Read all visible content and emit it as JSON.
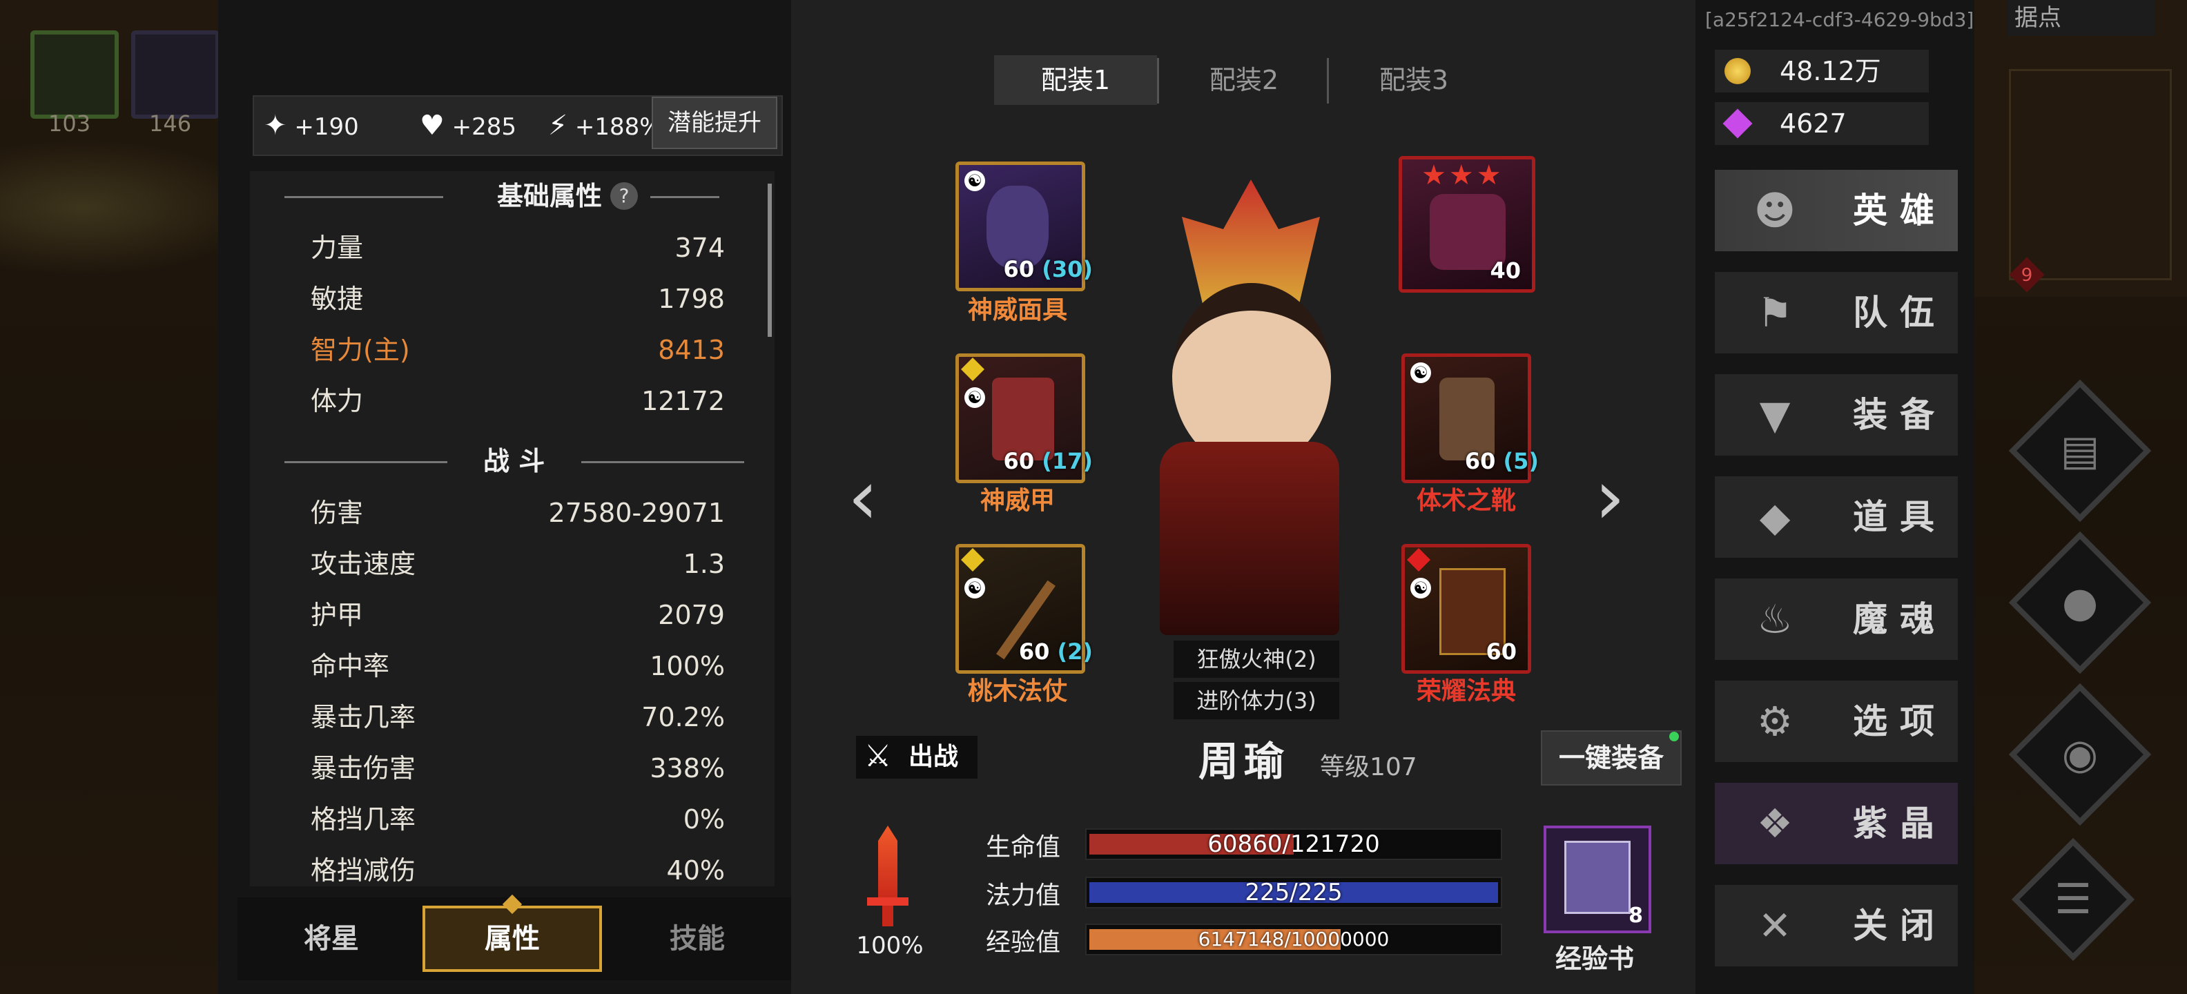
{
  "world": {
    "mini_slots": [
      "103",
      "146"
    ],
    "map_label": "据点",
    "map_badge": "9"
  },
  "session_id": "[a25f2124-cdf3-4629-9bd3]",
  "potential": {
    "strength": "+190",
    "health": "+285",
    "speed": "+188%",
    "button": "潜能提升"
  },
  "stats": {
    "basic_title": "基础属性",
    "help": "?",
    "basic": [
      {
        "k": "力量",
        "v": "374"
      },
      {
        "k": "敏捷",
        "v": "1798"
      },
      {
        "k": "智力(主)",
        "v": "8413"
      },
      {
        "k": "体力",
        "v": "12172"
      }
    ],
    "combat_title": "战 斗",
    "combat": [
      {
        "k": "伤害",
        "v": "27580-29071"
      },
      {
        "k": "攻击速度",
        "v": "1.3"
      },
      {
        "k": "护甲",
        "v": "2079"
      },
      {
        "k": "命中率",
        "v": "100%"
      },
      {
        "k": "暴击几率",
        "v": "70.2%"
      },
      {
        "k": "暴击伤害",
        "v": "338%"
      },
      {
        "k": "格挡几率",
        "v": "0%"
      },
      {
        "k": "格挡减伤",
        "v": "40%"
      }
    ]
  },
  "bottom_tabs": [
    "将星",
    "属性",
    "技能"
  ],
  "loadouts": [
    "配装1",
    "配装2",
    "配装3"
  ],
  "equipment": [
    {
      "name": "神威面具",
      "level": "60",
      "bonus": "(30)"
    },
    {
      "name": "神威甲",
      "level": "60",
      "bonus": "(17)"
    },
    {
      "name": "桃木法仗",
      "level": "60",
      "bonus": "(2)"
    },
    {
      "name": "",
      "level": "40",
      "bonus": ""
    },
    {
      "name": "体术之靴",
      "level": "60",
      "bonus": "(5)"
    },
    {
      "name": "荣耀法典",
      "level": "60",
      "bonus": ""
    }
  ],
  "set_bonuses": [
    "狂傲火神(2)",
    "进阶体力(3)"
  ],
  "deploy_label": "出战",
  "hero": {
    "name": "周瑜",
    "level": "等级107"
  },
  "auto_equip": "一键装备",
  "sword_percent": "100%",
  "bars": {
    "hp_label": "生命值",
    "hp": "60860/121720",
    "hp_frac": 0.5,
    "mp_label": "法力值",
    "mp": "225/225",
    "mp_frac": 1.0,
    "xp_label": "经验值",
    "xp": "6147148/10000000",
    "xp_frac": 0.615
  },
  "exp_book": {
    "count": "8",
    "label": "经验书"
  },
  "currency": {
    "gold": "48.12万",
    "gems": "4627"
  },
  "menu": [
    {
      "label": "英雄",
      "icon": "heroes-icon"
    },
    {
      "label": "队伍",
      "icon": "flag-icon"
    },
    {
      "label": "装备",
      "icon": "helmet-icon"
    },
    {
      "label": "道具",
      "icon": "bag-icon"
    },
    {
      "label": "魔魂",
      "icon": "flame-icon"
    },
    {
      "label": "选项",
      "icon": "gear-icon"
    },
    {
      "label": "紫晶",
      "icon": "crystal-icon"
    },
    {
      "label": "关闭",
      "icon": "close-icon"
    }
  ],
  "colors": {
    "accent_gold": "#d9a436",
    "primary_stat": "#e8893a",
    "teal_bonus": "#4fd0e6",
    "hp": "#a83028",
    "mp": "#2d3ea8",
    "xp": "#d87a3a",
    "red_item": "#e8392a",
    "orange_item": "#f08a3a"
  }
}
